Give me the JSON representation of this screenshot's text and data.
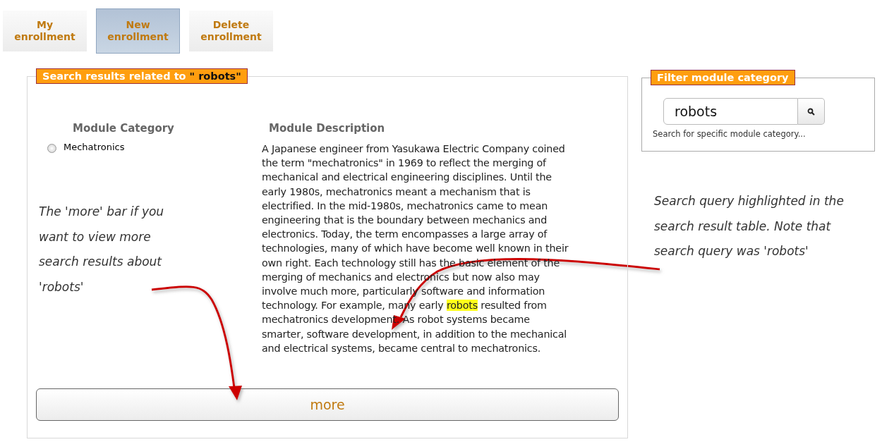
{
  "tabs": [
    {
      "label": "My enrollment",
      "selected": false
    },
    {
      "label": "New enrollment",
      "selected": true
    },
    {
      "label": "Delete enrollment",
      "selected": false
    }
  ],
  "results": {
    "title": "Search results related to",
    "query": "\" robots\"",
    "columns": [
      "Module Category",
      "Module Description"
    ],
    "rows": [
      {
        "category": "Mechatronics",
        "selected": false,
        "description": {
          "before": "A Japanese engineer from Yasukawa Electric Company coined the term \"mechatronics\" in 1969 to reflect the merging of mechanical and electrical engineering disciplines. Until the early 1980s, mechatronics meant a mechanism that is electrified. In the mid-1980s, mechatronics came to mean engineering that is the boundary between mechanics and electronics. Today, the term encompasses a large array of technologies, many of which have become well known in their own right. Each technology still has the basic element of the merging of mechanics and electronics but now also may involve much more, particularly software and information technology. For example, many early",
          "highlight": "robots",
          "after": "resulted from mechatronics development. As robot systems became smarter, software development, in addition to the mechanical and electrical systems, became central to mechatronics."
        }
      }
    ],
    "more_button": "more"
  },
  "filter": {
    "title": "Filter module category",
    "value": "robots",
    "hint": "Search for specific module category..."
  },
  "annotations": [
    {
      "text": "The 'more' bar if you want to view more search results about 'robots'"
    },
    {
      "text": "Search query highlighted in the search result table. Note that search query was 'robots'"
    }
  ]
}
